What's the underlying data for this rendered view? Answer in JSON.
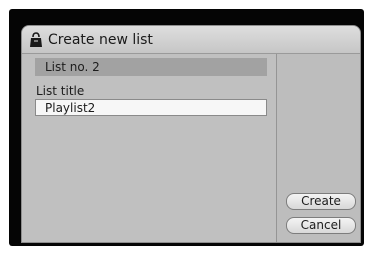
{
  "dialog": {
    "title": "Create new list",
    "title_icon": "bag-icon"
  },
  "list_number": {
    "label": "List no. 2"
  },
  "list_title": {
    "label": "List title",
    "value": "Playlist2"
  },
  "buttons": {
    "create_label": "Create",
    "cancel_label": "Cancel"
  },
  "colors": {
    "screen_background": "#050505",
    "dialog_background": "#bcbcbc",
    "titlebar": "#d2d2d2",
    "list_number_bar": "#a2a2a2",
    "input_background": "#f7f7f7"
  }
}
